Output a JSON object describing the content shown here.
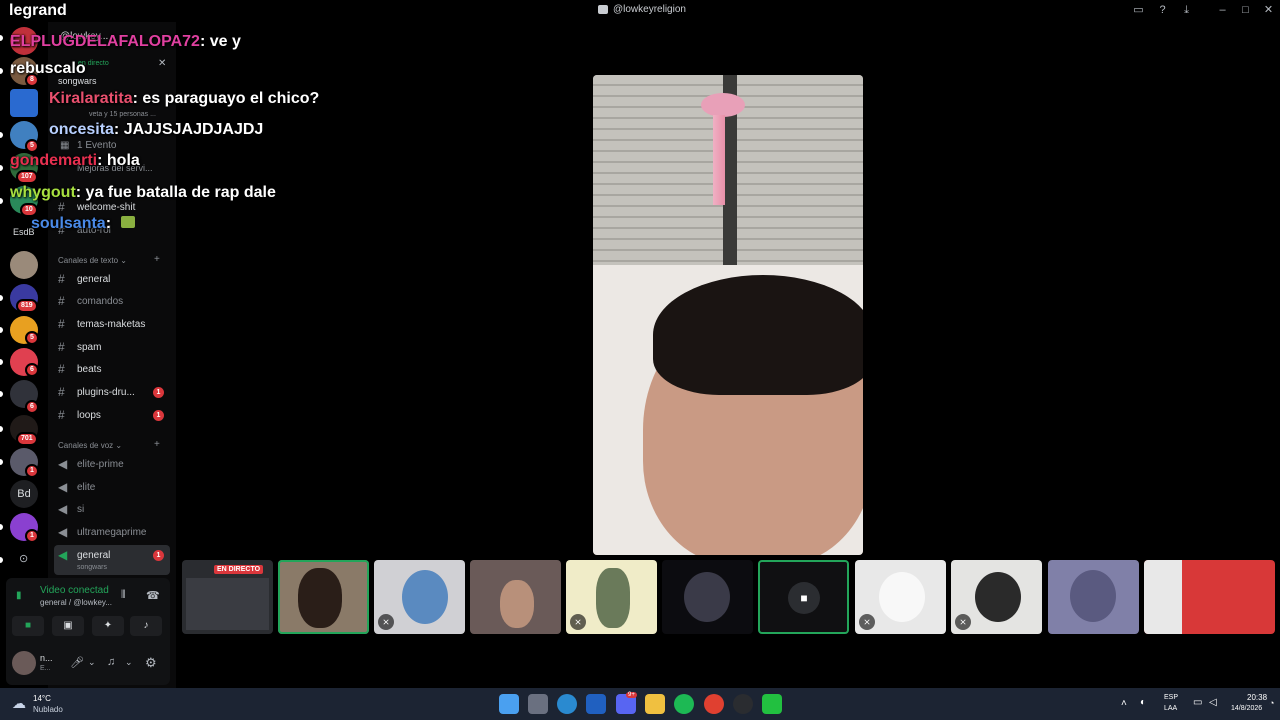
{
  "app": {
    "brand": "legrand",
    "window_title": "@lowkeyreligion"
  },
  "server": {
    "name": "@lowkey...",
    "live_label": "en directo",
    "live_channel": "songwars",
    "members_text": "veta y 15 personas ...",
    "events": "1 Evento",
    "boosts": "Mejoras del servi..."
  },
  "rail_badges": [
    "8",
    "5",
    "107",
    "10",
    "819",
    "5",
    "6",
    "6",
    "701",
    "1",
    "1"
  ],
  "rail_texts": {
    "esdb": "EsdB",
    "bd": "Bd"
  },
  "channels_top": [
    "welcome-shit",
    "auto-rol"
  ],
  "text_category": "Canales de texto",
  "text_channels": [
    {
      "name": "general",
      "unread": ""
    },
    {
      "name": "comandos",
      "unread": ""
    },
    {
      "name": "temas-maketas",
      "unread": ""
    },
    {
      "name": "spam",
      "unread": ""
    },
    {
      "name": "beats",
      "unread": ""
    },
    {
      "name": "plugins-dru...",
      "unread": "1"
    },
    {
      "name": "loops",
      "unread": "1"
    }
  ],
  "voice_category": "Canales de voz",
  "voice_channels": [
    {
      "name": "elite-prime",
      "sub": "",
      "unread": ""
    },
    {
      "name": "elite",
      "sub": "",
      "unread": ""
    },
    {
      "name": "si",
      "sub": "",
      "unread": ""
    },
    {
      "name": "ultramegaprime",
      "sub": "",
      "unread": ""
    },
    {
      "name": "general",
      "sub": "songwars",
      "unread": "1"
    }
  ],
  "chat": [
    {
      "user": "ELPLUGDELAFALOPA72",
      "text": ": ve y",
      "color": "#e040a0"
    },
    {
      "user": "",
      "text": "rebuscalo",
      "color": "#ffffff"
    },
    {
      "user": "Kiralaratita",
      "text": ": es paraguayo el chico?",
      "color": "#e8506e"
    },
    {
      "user": "oncesita",
      "text": ": JAJJSJAJDJAJDJ",
      "color": "#b8d0ff"
    },
    {
      "user": "gondemarti",
      "text": ": hola",
      "color": "#e83050"
    },
    {
      "user": "whygout",
      "text": ": ya fue batalla de rap dale",
      "color": "#a8e040"
    },
    {
      "user": "soulsanta",
      "text": ":",
      "color": "#4a8ae8"
    }
  ],
  "tiles": [
    {
      "label": "EN DIRECTO",
      "bg": "#2a2c30"
    },
    {
      "label": "",
      "bg": "#8a7a68"
    },
    {
      "label": "",
      "bg": "#d0d0d4"
    },
    {
      "label": "",
      "bg": "#6a5a58"
    },
    {
      "label": "",
      "bg": "#f0ecc8"
    },
    {
      "label": "",
      "bg": "#0c0c10"
    },
    {
      "label": "",
      "bg": "#101012"
    },
    {
      "label": "",
      "bg": "#e8e8e8"
    },
    {
      "label": "",
      "bg": "#e4e4e2"
    },
    {
      "label": "",
      "bg": "#8080a8"
    },
    {
      "label": "",
      "bg": "#d83838"
    }
  ],
  "voice_panel": {
    "status": "Video conectad",
    "location": "general / @lowkey...",
    "user": "n...",
    "user_sub": "E..."
  },
  "taskbar": {
    "weather_temp": "14°C",
    "weather_desc": "Nublado",
    "lang": "ESP",
    "lang_sub": "LAA",
    "time": "20:38",
    "date": "14/8/2026",
    "discord_badge": "9+"
  },
  "colors": {
    "accent_green": "#23a55a",
    "badge_red": "#da373c",
    "taskbar": "#1c2433"
  }
}
